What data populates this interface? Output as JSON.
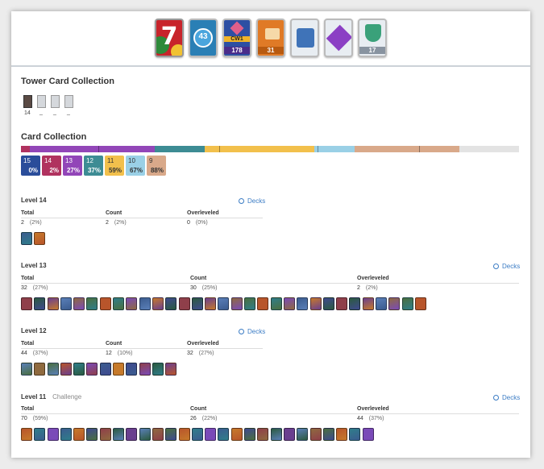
{
  "header": {
    "badges": [
      {
        "name": "level-badge",
        "text": "7"
      },
      {
        "name": "exp-level-badge",
        "text": "43"
      },
      {
        "name": "clan-war-badge",
        "text": "CW1",
        "sub": "178"
      },
      {
        "name": "cards-badge",
        "text": "31"
      },
      {
        "name": "arena-badge",
        "text": ""
      },
      {
        "name": "emote-badge",
        "text": ""
      },
      {
        "name": "trophy-badge",
        "text": "17"
      }
    ]
  },
  "tower": {
    "title": "Tower Card Collection",
    "cards": [
      {
        "label": "14"
      },
      {
        "label": "_"
      },
      {
        "label": "_"
      },
      {
        "label": "_"
      }
    ]
  },
  "collection": {
    "title": "Card Collection",
    "levels": [
      {
        "level": "15",
        "percent": "0%",
        "color": "#2a4d9a"
      },
      {
        "level": "14",
        "percent": "2%",
        "color": "#b0325f"
      },
      {
        "level": "13",
        "percent": "27%",
        "color": "#9246b8"
      },
      {
        "level": "12",
        "percent": "37%",
        "color": "#3d8c94"
      },
      {
        "level": "11",
        "percent": "59%",
        "color": "#f2c04c"
      },
      {
        "level": "10",
        "percent": "67%",
        "color": "#9ad0e6"
      },
      {
        "level": "9",
        "percent": "88%",
        "color": "#d9a98a"
      }
    ]
  },
  "sections": [
    {
      "title": "Level 14",
      "subtitle": "",
      "decks": "Decks",
      "total_label": "Total",
      "total": "2",
      "total_pct": "(2%)",
      "count_label": "Count",
      "count": "2",
      "count_pct": "(2%)",
      "over_label": "Overleveled",
      "over": "0",
      "over_pct": "(0%)",
      "card_count": 2
    },
    {
      "title": "Level 13",
      "subtitle": "",
      "decks": "Decks",
      "total_label": "Total",
      "total": "32",
      "total_pct": "(27%)",
      "count_label": "Count",
      "count": "30",
      "count_pct": "(25%)",
      "over_label": "Overleveled",
      "over": "2",
      "over_pct": "(2%)",
      "card_count": 32
    },
    {
      "title": "Level 12",
      "subtitle": "",
      "decks": "Decks",
      "total_label": "Total",
      "total": "44",
      "total_pct": "(37%)",
      "count_label": "Count",
      "count": "12",
      "count_pct": "(10%)",
      "over_label": "Overleveled",
      "over": "32",
      "over_pct": "(27%)",
      "card_count": 12
    },
    {
      "title": "Level 11",
      "subtitle": "Challenge",
      "decks": "Decks",
      "total_label": "Total",
      "total": "70",
      "total_pct": "(59%)",
      "count_label": "Count",
      "count": "26",
      "count_pct": "(22%)",
      "over_label": "Overleveled",
      "over": "44",
      "over_pct": "(37%)",
      "card_count": 26
    }
  ]
}
